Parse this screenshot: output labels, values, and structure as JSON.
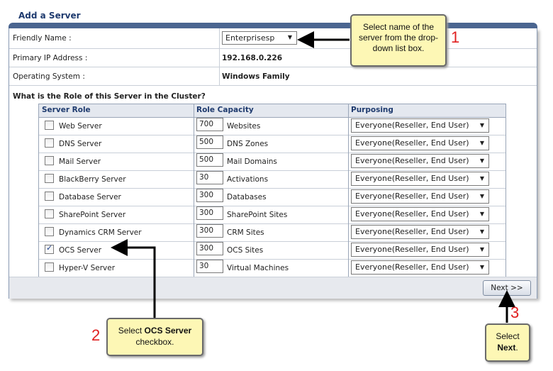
{
  "panel": {
    "title": "Add a Server"
  },
  "fields": {
    "friendly_name_label": "Friendly Name :",
    "friendly_name_value": "Enterprisesp",
    "ip_label": "Primary IP Address :",
    "ip_value": "192.168.0.226",
    "os_label": "Operating System :",
    "os_value": "Windows Family"
  },
  "roles_section_label": "What is the Role of this Server in the Cluster?",
  "table": {
    "headers": [
      "Server Role",
      "Role Capacity",
      "Purposing"
    ],
    "rows": [
      {
        "role": "Web Server",
        "checked": false,
        "capacity": "700",
        "unit": "Websites",
        "purposing": "Everyone(Reseller, End User)"
      },
      {
        "role": "DNS Server",
        "checked": false,
        "capacity": "500",
        "unit": "DNS Zones",
        "purposing": "Everyone(Reseller, End User)"
      },
      {
        "role": "Mail Server",
        "checked": false,
        "capacity": "500",
        "unit": "Mail Domains",
        "purposing": "Everyone(Reseller, End User)"
      },
      {
        "role": "BlackBerry Server",
        "checked": false,
        "capacity": "30",
        "unit": "Activations",
        "purposing": "Everyone(Reseller, End User)"
      },
      {
        "role": "Database Server",
        "checked": false,
        "capacity": "300",
        "unit": "Databases",
        "purposing": "Everyone(Reseller, End User)"
      },
      {
        "role": "SharePoint Server",
        "checked": false,
        "capacity": "300",
        "unit": "SharePoint Sites",
        "purposing": "Everyone(Reseller, End User)"
      },
      {
        "role": "Dynamics CRM Server",
        "checked": false,
        "capacity": "300",
        "unit": "CRM Sites",
        "purposing": "Everyone(Reseller, End User)"
      },
      {
        "role": "OCS Server",
        "checked": true,
        "capacity": "300",
        "unit": "OCS Sites",
        "purposing": "Everyone(Reseller, End User)"
      },
      {
        "role": "Hyper-V Server",
        "checked": false,
        "capacity": "30",
        "unit": "Virtual Machines",
        "purposing": "Everyone(Reseller, End User)"
      }
    ]
  },
  "next_label": "Next >>",
  "callouts": {
    "one": {
      "number": "1",
      "text": "Select name of the server from the drop-down list box."
    },
    "two": {
      "number": "2",
      "pre": "Select ",
      "bold": "OCS Server",
      "post": " checkbox."
    },
    "three": {
      "number": "3",
      "pre": "Select ",
      "bold": "Next",
      "post": "."
    }
  },
  "colors": {
    "header_bar": "#4a6590",
    "callout_bg": "#fdf7b5",
    "step_number": "#e02020"
  }
}
